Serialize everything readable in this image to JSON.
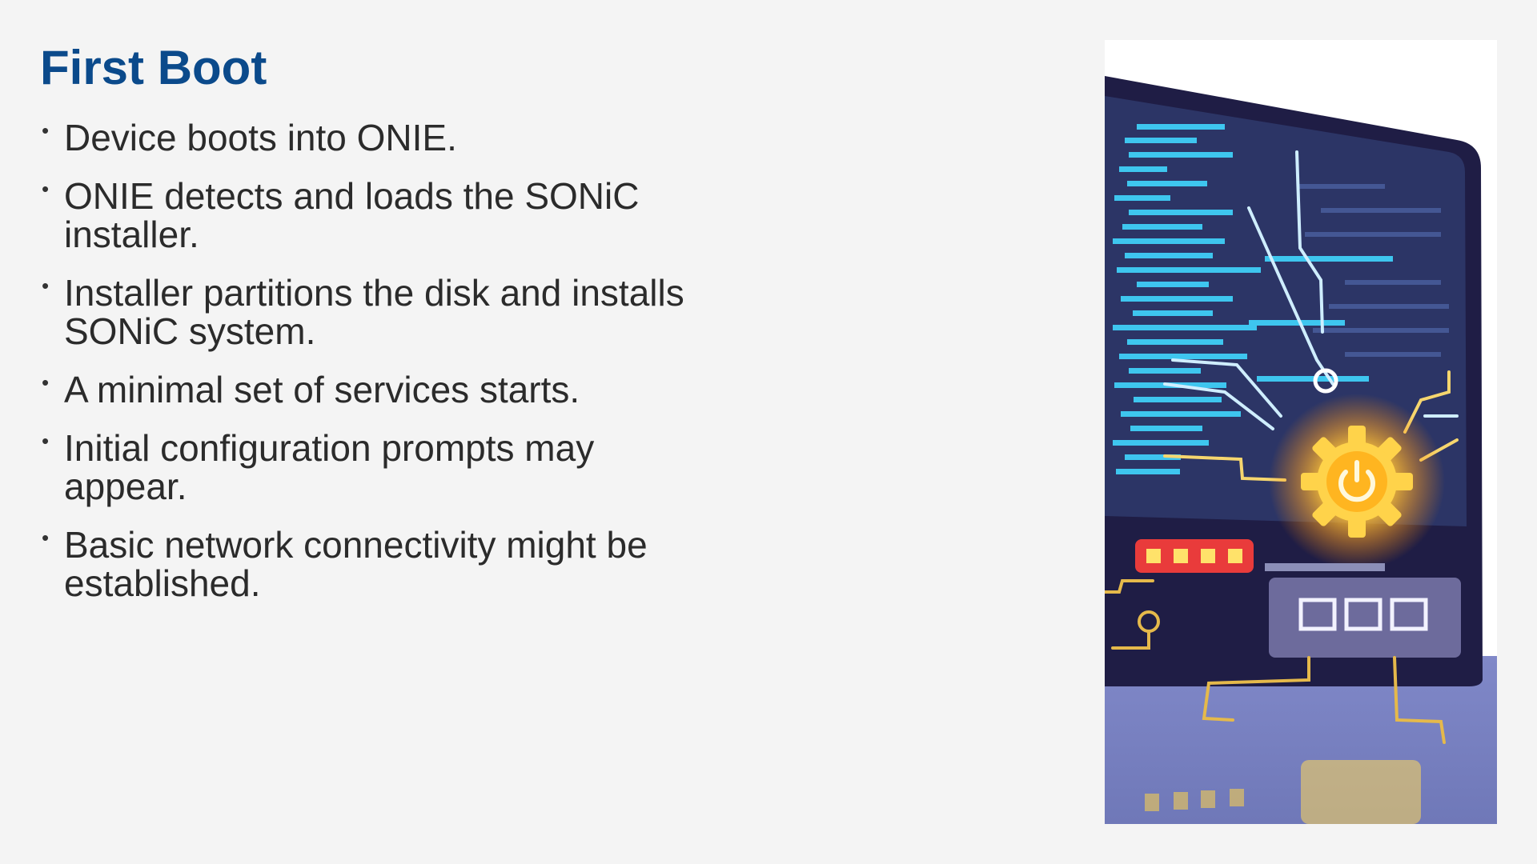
{
  "slide": {
    "title": "First Boot",
    "bullets": [
      "Device boots into ONIE.",
      "ONIE detects and loads the SONiC installer.",
      "Installer partitions the disk and installs SONiC system.",
      "A minimal set of services starts.",
      "Initial configuration prompts may appear.",
      "Basic network connectivity might be established."
    ],
    "bullet_glyph": "•"
  },
  "illustration": {
    "subject": "network-switch-boot-illustration",
    "icons": [
      "power-gear-icon",
      "status-led-icon",
      "port-icon"
    ],
    "colors": {
      "frame": "#25234f",
      "screen": "#2e3a6e",
      "code": "#3ec6ef",
      "glow": "#ffb21c",
      "circuit": "#e5b94b",
      "led": "#e93b3b",
      "reflection": "#7b84c4"
    }
  }
}
